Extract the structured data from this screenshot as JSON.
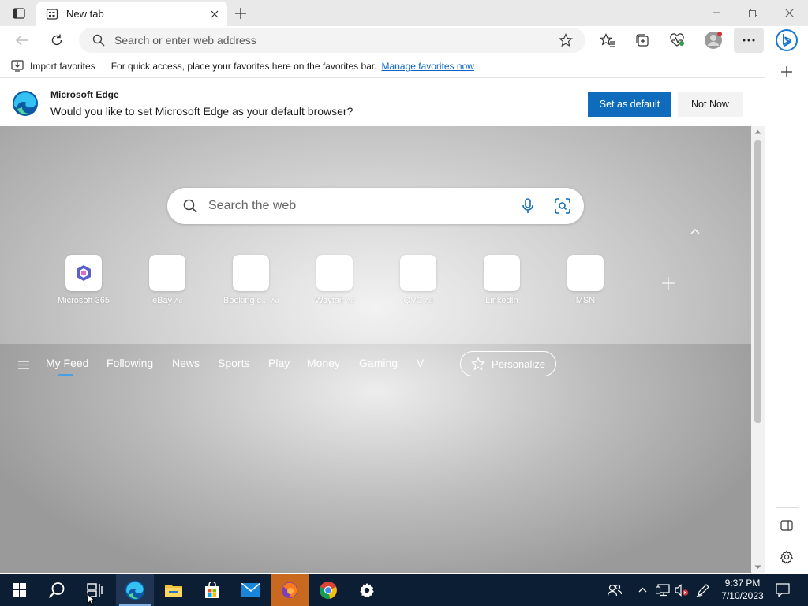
{
  "tab": {
    "title": "New tab"
  },
  "address_bar": {
    "placeholder": "Search or enter web address"
  },
  "favorites_bar": {
    "import_label": "Import favorites",
    "message": "For quick access, place your favorites here on the favorites bar.",
    "manage_link": "Manage favorites now"
  },
  "default_prompt": {
    "title": "Microsoft Edge",
    "question": "Would you like to set Microsoft Edge as your default browser?",
    "set_default": "Set as default",
    "not_now": "Not Now"
  },
  "search": {
    "placeholder": "Search the web"
  },
  "quick_links": [
    {
      "label": "Microsoft 365",
      "ad": ""
    },
    {
      "label": "eBay",
      "ad": "Ad"
    },
    {
      "label": "Booking.c...",
      "ad": "Ad"
    },
    {
      "label": "Wayfair",
      "ad": "Ad"
    },
    {
      "label": "QVC",
      "ad": "Ad"
    },
    {
      "label": "LinkedIn",
      "ad": ""
    },
    {
      "label": "MSN",
      "ad": ""
    }
  ],
  "feed_nav": {
    "items": [
      "My Feed",
      "Following",
      "News",
      "Sports",
      "Play",
      "Money",
      "Gaming",
      "V"
    ],
    "personalize": "Personalize"
  },
  "clock": {
    "time": "9:37 PM",
    "date": "7/10/2023"
  },
  "colors": {
    "accent": "#0f6cbd",
    "taskbar": "#0b1e33",
    "link": "#0a63c8"
  },
  "icons": {
    "tab_actions": "tab-actions-icon",
    "back": "back-arrow-icon",
    "refresh": "refresh-icon",
    "favorite": "star-icon",
    "favorites": "favorites-icon",
    "collections": "collections-icon",
    "performance": "heart-pulse-icon",
    "profile": "profile-icon",
    "more": "more-icon",
    "copilot": "bing-icon"
  }
}
